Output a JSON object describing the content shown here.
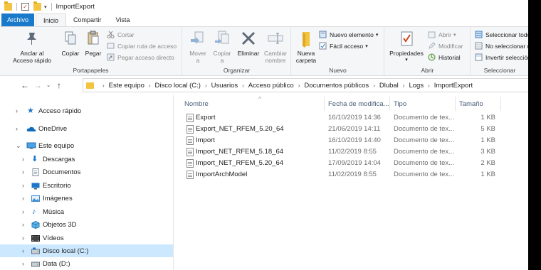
{
  "window": {
    "title": "ImportExport"
  },
  "tabs": [
    {
      "label": "Archivo"
    },
    {
      "label": "Inicio"
    },
    {
      "label": "Compartir"
    },
    {
      "label": "Vista"
    }
  ],
  "ribbon": {
    "portapapeles": {
      "label": "Portapapeles",
      "pin": "Anclar al\nAcceso rápido",
      "copy": "Copiar",
      "paste": "Pegar",
      "cut": "Cortar",
      "copy_path": "Copiar ruta de acceso",
      "paste_shortcut": "Pegar acceso directo"
    },
    "organizar": {
      "label": "Organizar",
      "move": "Mover\na",
      "copyto": "Copiar\na",
      "delete": "Eliminar",
      "rename": "Cambiar\nnombre"
    },
    "nuevo": {
      "label": "Nuevo",
      "new_folder": "Nueva\ncarpeta",
      "new_item": "Nuevo elemento",
      "easy_access": "Fácil acceso"
    },
    "abrir": {
      "label": "Abrir",
      "properties": "Propiedades",
      "open": "Abrir",
      "edit": "Modificar",
      "history": "Historial"
    },
    "seleccionar": {
      "label": "Seleccionar",
      "select_all": "Seleccionar todo",
      "select_none": "No seleccionar nada",
      "invert": "Invertir selección"
    }
  },
  "address": {
    "crumbs": [
      "Este equipo",
      "Disco local (C:)",
      "Usuarios",
      "Acceso público",
      "Documentos públicos",
      "Dlubal",
      "Logs",
      "ImportExport"
    ]
  },
  "nav": [
    {
      "label": "Acceso rápido",
      "icon": "star-icon"
    },
    {
      "label": "OneDrive",
      "icon": "cloud-icon"
    },
    {
      "label": "Este equipo",
      "icon": "computer-icon"
    },
    {
      "label": "Descargas",
      "icon": "download-icon"
    },
    {
      "label": "Documentos",
      "icon": "documents-icon"
    },
    {
      "label": "Escritorio",
      "icon": "desktop-icon"
    },
    {
      "label": "Imágenes",
      "icon": "pictures-icon"
    },
    {
      "label": "Música",
      "icon": "music-icon"
    },
    {
      "label": "Objetos 3D",
      "icon": "3d-objects-icon"
    },
    {
      "label": "Vídeos",
      "icon": "videos-icon"
    },
    {
      "label": "Disco local (C:)",
      "icon": "drive-icon",
      "selected": true
    },
    {
      "label": "Data (D:)",
      "icon": "drive-icon"
    }
  ],
  "columns": {
    "name": "Nombre",
    "modified": "Fecha de modifica...",
    "type": "Tipo",
    "size": "Tamaño"
  },
  "files": [
    {
      "name": "Export",
      "modified": "16/10/2019 14:36",
      "type": "Documento de tex...",
      "size": "1 KB"
    },
    {
      "name": "Export_NET_RFEM_5.20_64",
      "modified": "21/06/2019 14:11",
      "type": "Documento de tex...",
      "size": "5 KB"
    },
    {
      "name": "Import",
      "modified": "16/10/2019 14:40",
      "type": "Documento de tex...",
      "size": "1 KB"
    },
    {
      "name": "Import_NET_RFEM_5.18_64",
      "modified": "11/02/2019 8:55",
      "type": "Documento de tex...",
      "size": "3 KB"
    },
    {
      "name": "Import_NET_RFEM_5.20_64",
      "modified": "17/09/2019 14:04",
      "type": "Documento de tex...",
      "size": "2 KB"
    },
    {
      "name": "ImportArchModel",
      "modified": "11/02/2019 8:55",
      "type": "Documento de tex...",
      "size": "1 KB"
    }
  ],
  "colors": {
    "accent": "#1979ca",
    "selection": "#cce8ff",
    "folder": "#f3c342"
  }
}
